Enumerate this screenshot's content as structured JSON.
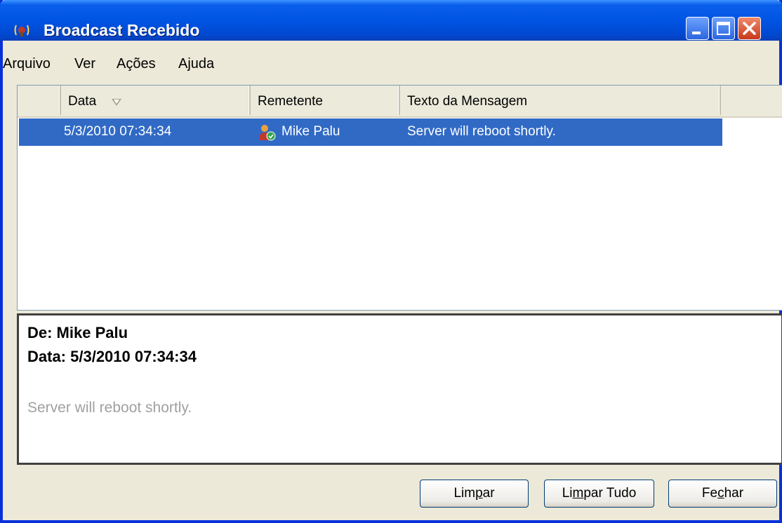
{
  "window": {
    "title": "Broadcast Recebido"
  },
  "menu": [
    "Arquivo",
    "Ver",
    "Ações",
    "Ajuda"
  ],
  "columns": [
    "Data",
    "Remetente",
    "Texto da Mensagem"
  ],
  "messages": [
    {
      "date": "5/3/2010 07:34:34",
      "sender": "Mike Palu",
      "text": "Server will reboot shortly.",
      "selected": true
    }
  ],
  "preview": {
    "from_line": "De: Mike Palu",
    "date_line": "Data: 5/3/2010 07:34:34",
    "body": "Server will reboot shortly."
  },
  "buttons": {
    "clear": {
      "pre": "Lim",
      "mnemonic": "p",
      "post": "ar"
    },
    "clear_all": {
      "pre": "Li",
      "mnemonic": "m",
      "post": "par Tudo"
    },
    "close": {
      "pre": "Fe",
      "mnemonic": "c",
      "post": "har"
    }
  },
  "colors": {
    "titlebar": "#0054e3",
    "selection": "#316ac5",
    "face": "#ece9d8"
  }
}
